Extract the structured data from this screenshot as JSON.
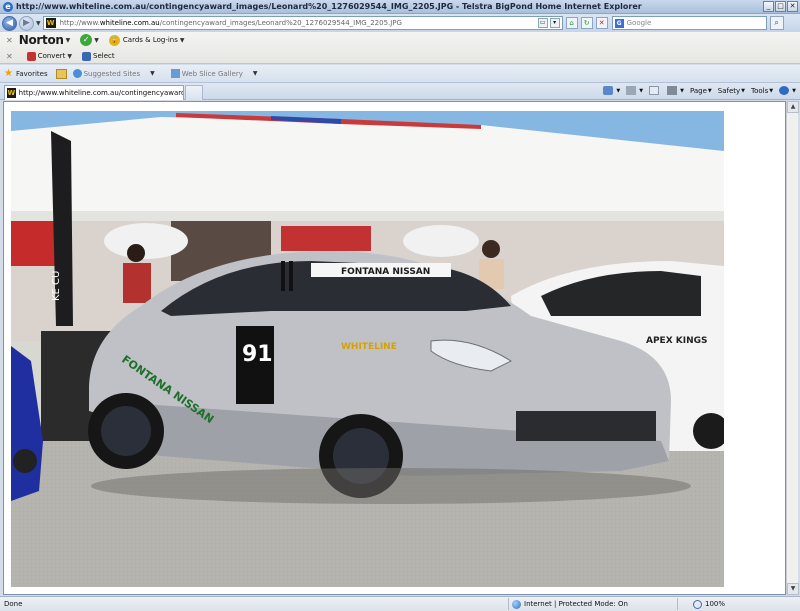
{
  "window": {
    "title": "http://www.whiteline.com.au/contingencyaward_images/Leonard%20_1276029544_IMG_2205.JPG - Telstra BigPond Home Internet Explorer",
    "buttons": {
      "minimize": "_",
      "maximize": "□",
      "close": "✕"
    }
  },
  "address_bar": {
    "url_prefix": "http://www.",
    "url_domain": "whiteline.com.au",
    "url_path": "/contingencyaward_images/Leonard%20_1276029544_IMG_2205.JPG",
    "search_placeholder": "Google"
  },
  "norton_toolbar": {
    "brand": "Norton",
    "cards_label": "Cards & Log-ins",
    "convert_label": "Convert",
    "select_label": "Select"
  },
  "favorites_bar": {
    "favorites_label": "Favorites",
    "suggested_sites_label": "Suggested Sites",
    "web_slice_label": "Web Slice Gallery"
  },
  "tabs": [
    {
      "label": "http://www.whiteline.com.au/contingencyaward_ima..."
    }
  ],
  "command_bar": {
    "page_label": "Page",
    "safety_label": "Safety",
    "tools_label": "Tools"
  },
  "photo": {
    "car_number": "91",
    "windshield_banner": "FONTANA NISSAN",
    "side_sponsor": "FONTANA NISSAN",
    "whiteline_decal": "WHITELINE",
    "tent_flag_text": "KE CU",
    "neighbour_car_sponsor": "APEX KINGS"
  },
  "status_bar": {
    "left_text": "Done",
    "zone_text": "Internet | Protected Mode: On",
    "zoom_text": "100%"
  }
}
